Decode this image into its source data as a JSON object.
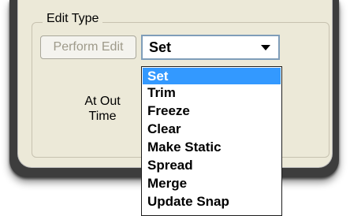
{
  "group": {
    "title": "Edit Type"
  },
  "perform_button": {
    "label": "Perform Edit"
  },
  "combo": {
    "value": "Set"
  },
  "field": {
    "label_line1": "At Out",
    "label_line2": "Time"
  },
  "dropdown": {
    "items": [
      "Set",
      "Trim",
      "Freeze",
      "Clear",
      "Make Static",
      "Spread",
      "Merge",
      "Update Snap"
    ],
    "selected_index": 0
  },
  "colors": {
    "highlight": "#3399ff",
    "panel": "#ece9d8",
    "frame": "#3d3d3d"
  }
}
